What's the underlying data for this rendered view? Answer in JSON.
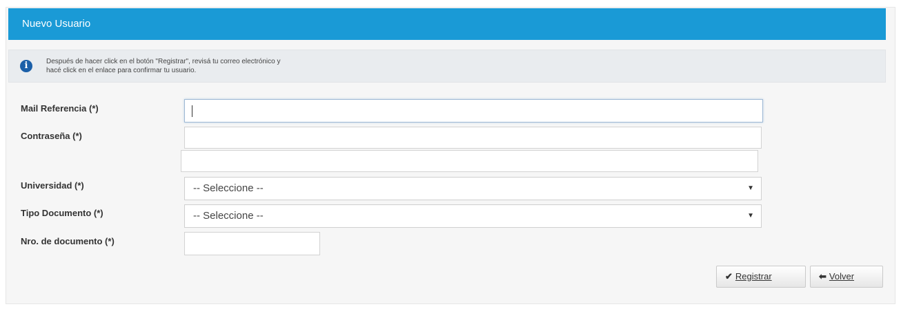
{
  "header": {
    "title": "Nuevo Usuario"
  },
  "info": {
    "icon": "info-circle-icon",
    "line1": "Después de hacer click en el botón \"Registrar\", revisá tu correo electrónico y",
    "line2": "hacé click en el enlace para confirmar tu usuario."
  },
  "form": {
    "mail_label": "Mail Referencia (*)",
    "mail_value": "",
    "password_label": "Contraseña (*)",
    "password_value": "",
    "password_confirm_value": "",
    "university_label": "Universidad (*)",
    "university_selected": "-- Seleccione --",
    "doc_type_label": "Tipo Documento (*)",
    "doc_type_selected": "-- Seleccione --",
    "doc_number_label": "Nro. de documento (*)",
    "doc_number_value": ""
  },
  "actions": {
    "register_label": "Registrar",
    "register_icon": "checkmark-icon",
    "back_label": "Volver",
    "back_icon": "arrow-left-icon"
  },
  "colors": {
    "header_bg": "#1a9ad6",
    "info_icon": "#1b5fa8"
  }
}
